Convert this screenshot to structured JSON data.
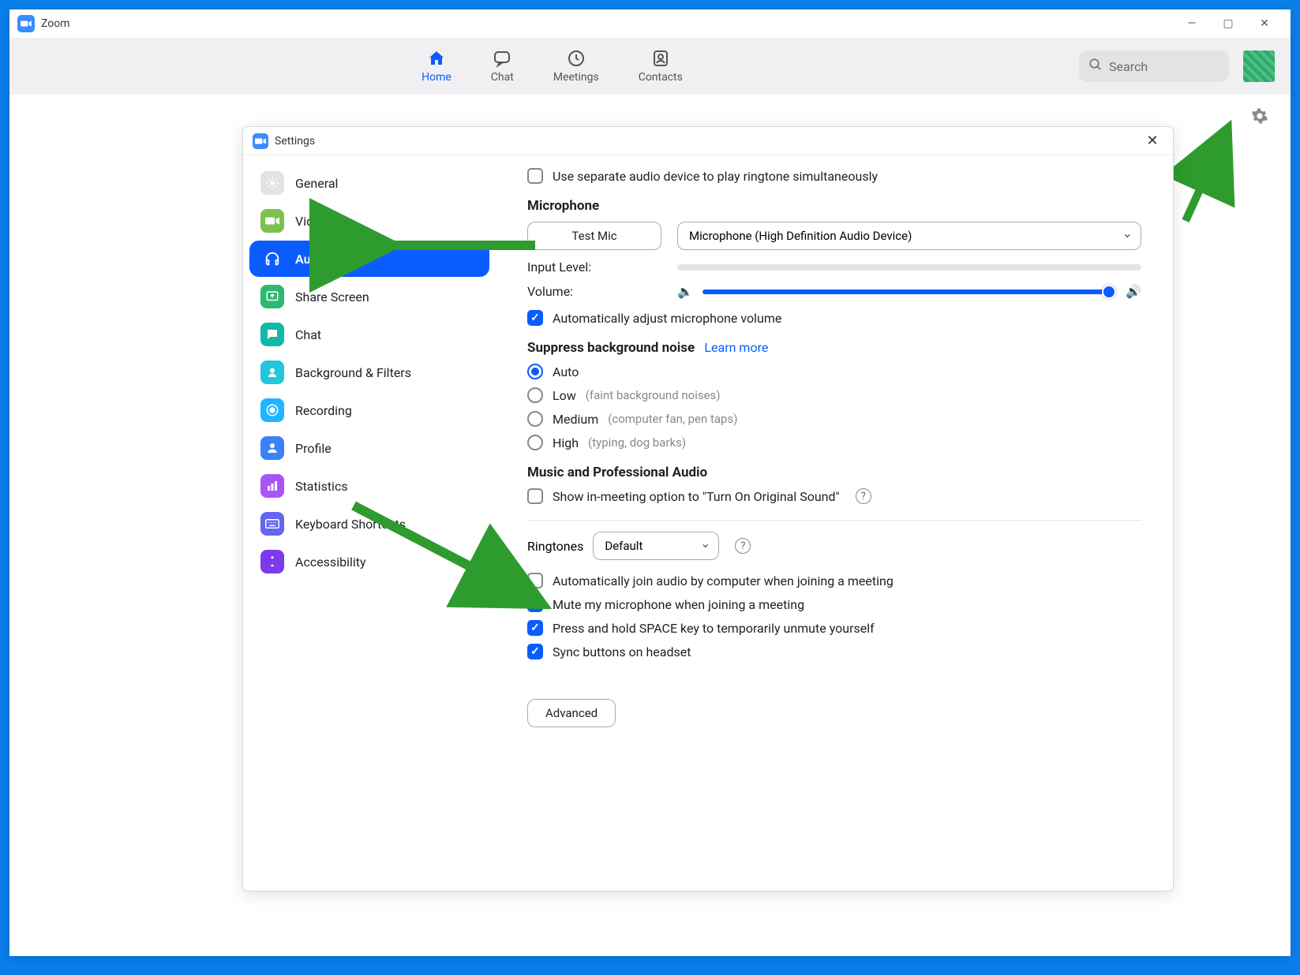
{
  "app": {
    "title": "Zoom"
  },
  "nav": {
    "items": [
      {
        "label": "Home"
      },
      {
        "label": "Chat"
      },
      {
        "label": "Meetings"
      },
      {
        "label": "Contacts"
      }
    ]
  },
  "search": {
    "placeholder": "Search"
  },
  "settings": {
    "title": "Settings",
    "sidebar": [
      {
        "label": "General"
      },
      {
        "label": "Video"
      },
      {
        "label": "Audio"
      },
      {
        "label": "Share Screen"
      },
      {
        "label": "Chat"
      },
      {
        "label": "Background & Filters"
      },
      {
        "label": "Recording"
      },
      {
        "label": "Profile"
      },
      {
        "label": "Statistics"
      },
      {
        "label": "Keyboard Shortcuts"
      },
      {
        "label": "Accessibility"
      }
    ],
    "audio": {
      "separate_device": "Use separate audio device to play ringtone simultaneously",
      "mic_section": "Microphone",
      "test_mic": "Test Mic",
      "mic_device": "Microphone (High Definition Audio Device)",
      "input_level": "Input Level:",
      "volume": "Volume:",
      "auto_adjust": "Automatically adjust microphone volume",
      "suppress_head": "Suppress background noise",
      "learn_more": "Learn more",
      "noise_auto": "Auto",
      "noise_low": "Low",
      "noise_low_hint": "(faint background noises)",
      "noise_med": "Medium",
      "noise_med_hint": "(computer fan, pen taps)",
      "noise_high": "High",
      "noise_high_hint": "(typing, dog barks)",
      "music_head": "Music and Professional Audio",
      "original_sound": "Show in-meeting option to \"Turn On Original Sound\"",
      "ringtones_label": "Ringtones",
      "ringtones_value": "Default",
      "auto_join": "Automatically join audio by computer when joining a meeting",
      "mute_join": "Mute my microphone when joining a meeting",
      "space_unmute": "Press and hold SPACE key to temporarily unmute yourself",
      "sync_headset": "Sync buttons on headset",
      "advanced": "Advanced"
    }
  }
}
